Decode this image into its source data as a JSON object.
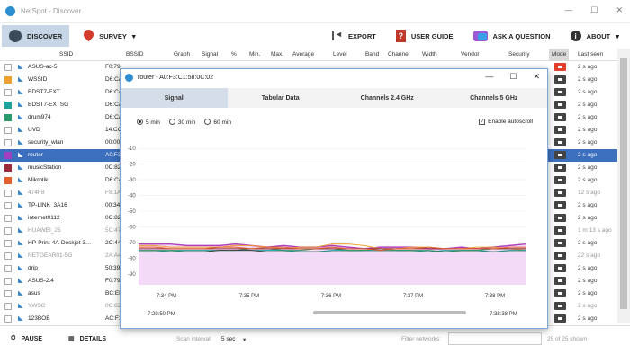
{
  "window": {
    "title": "NetSpot - Discover",
    "controls": [
      "—",
      "☐",
      "✕"
    ]
  },
  "toolbar": {
    "discover_label": "DISCOVER",
    "survey_label": "SURVEY",
    "survey_arrow": "▾",
    "export_label": "EXPORT",
    "guide_label": "USER GUIDE",
    "ask_label": "ASK A QUESTION",
    "about_label": "ABOUT",
    "about_arrow": "▾",
    "guide_glyph": "?",
    "about_glyph": "i"
  },
  "table": {
    "columns": [
      "SSID",
      "BSSID",
      "Graph",
      "Signal",
      "%",
      "Min.",
      "Max.",
      "Average",
      "Level",
      "Band",
      "Channel",
      "Width",
      "Vendor",
      "Security",
      "Mode",
      "Last seen"
    ],
    "rows": [
      {
        "ssid": "ASUS-ac-5",
        "bssid": "F0:79",
        "mode": "ac",
        "last": "2 s ago",
        "check": "none",
        "dim": false
      },
      {
        "ssid": "WSSID",
        "bssid": "D6:CA",
        "mode": "n",
        "last": "2 s ago",
        "check": "#f0a030",
        "dim": false
      },
      {
        "ssid": "BDST7-EXT",
        "bssid": "D6:CA",
        "mode": "n",
        "last": "2 s ago",
        "check": "none",
        "dim": false
      },
      {
        "ssid": "BDST7-EXTSG",
        "bssid": "D6:CA",
        "mode": "n",
        "last": "2 s ago",
        "check": "#1ba39c",
        "dim": false
      },
      {
        "ssid": "drum974",
        "bssid": "D6:CA",
        "mode": "n",
        "last": "2 s ago",
        "check": "#2a9a6a",
        "dim": false
      },
      {
        "ssid": "UVD",
        "bssid": "14:CC",
        "mode": "n",
        "last": "2 s ago",
        "check": "none",
        "dim": false
      },
      {
        "ssid": "security_wlan",
        "bssid": "00:00",
        "mode": "n",
        "last": "2 s ago",
        "check": "none",
        "dim": false
      },
      {
        "ssid": "router",
        "bssid": "A0:F3",
        "mode": "n",
        "last": "2 s ago",
        "check": "#a040c0",
        "dim": false,
        "selected": true
      },
      {
        "ssid": "musicStation",
        "bssid": "0C:82",
        "mode": "n",
        "last": "2 s ago",
        "check": "#9b2b3a",
        "dim": false
      },
      {
        "ssid": "Mikrotik",
        "bssid": "D6:CA",
        "mode": "n",
        "last": "2 s ago",
        "check": "#e06030",
        "dim": false
      },
      {
        "ssid": "474F8",
        "bssid": "F8:1A",
        "mode": "n",
        "last": "12 s ago",
        "check": "none",
        "dim": true
      },
      {
        "ssid": "TP-LINK_3A16",
        "bssid": "00:34",
        "mode": "n",
        "last": "2 s ago",
        "check": "none",
        "dim": false
      },
      {
        "ssid": "internet0112",
        "bssid": "0C:82",
        "mode": "n",
        "last": "2 s ago",
        "check": "none",
        "dim": false
      },
      {
        "ssid": "HUAWEI_25",
        "bssid": "5C:47",
        "mode": "n",
        "last": "1 m 13 s ago",
        "check": "none",
        "dim": true
      },
      {
        "ssid": "HP-Print-4A-Deskjet 3…",
        "bssid": "2C:44",
        "mode": "n",
        "last": "2 s ago",
        "check": "none",
        "dim": false
      },
      {
        "ssid": "NETGEAR01-5G",
        "bssid": "2A:A4",
        "mode": "n",
        "last": "22 s ago",
        "check": "none",
        "dim": true
      },
      {
        "ssid": "drip",
        "bssid": "50:39",
        "mode": "n",
        "last": "2 s ago",
        "check": "none",
        "dim": false
      },
      {
        "ssid": "ASUS-2.4",
        "bssid": "F0:79",
        "mode": "n",
        "last": "2 s ago",
        "check": "none",
        "dim": false
      },
      {
        "ssid": "asus",
        "bssid": "BC:EE",
        "mode": "n",
        "last": "2 s ago",
        "check": "none",
        "dim": false
      },
      {
        "ssid": "YWSC",
        "bssid": "0C:82",
        "mode": "n",
        "last": "2 s ago",
        "check": "none",
        "dim": true
      },
      {
        "ssid": "123BOB",
        "bssid": "AC:F1",
        "mode": "n",
        "last": "2 s ago",
        "check": "none",
        "dim": false
      }
    ]
  },
  "statusbar": {
    "pause_label": "PAUSE",
    "details_label": "DETAILS",
    "scan_interval_label": "Scan interval:",
    "scan_interval_value": "5 sec",
    "filter_label": "Filter networks:",
    "filter_value": "",
    "count_text": "25 of 25 shown"
  },
  "popup": {
    "title": "router - A0:F3:C1:58:0C:02",
    "controls": [
      "—",
      "☐",
      "✕"
    ],
    "tabs": [
      "Signal",
      "Tabular Data",
      "Channels 2.4 GHz",
      "Channels 5 GHz"
    ],
    "active_tab": 0,
    "ranges": [
      "5 min",
      "30 min",
      "60 min"
    ],
    "selected_range": 0,
    "autoscroll_label": "Enable autoscroll",
    "autoscroll_checked": true
  },
  "chart_data": {
    "type": "line",
    "title": "",
    "xlabel": "",
    "ylabel": "",
    "ylim": [
      -97,
      -3
    ],
    "yticks": [
      -10,
      -20,
      -30,
      -40,
      -50,
      -60,
      -70,
      -80,
      -90
    ],
    "xticks": [
      "7:34 PM",
      "7:35 PM",
      "7:36 PM",
      "7:37 PM",
      "7:38 PM"
    ],
    "range_start": "7:29:50 PM",
    "range_end": "7:38:38 PM",
    "fill_color": "#f3daf6",
    "fill_series": "router",
    "series": [
      {
        "name": "router",
        "color": "#b040c0",
        "values": [
          -71,
          -71,
          -71,
          -72,
          -72,
          -72,
          -71,
          -72,
          -73,
          -72,
          -73,
          -73,
          -72,
          -73,
          -74,
          -73,
          -73,
          -73,
          -74,
          -74,
          -73,
          -74,
          -73,
          -72,
          -71
        ]
      },
      {
        "color": "#f0a030",
        "values": [
          -72,
          -72,
          -73,
          -73,
          -73,
          -73,
          -72,
          -72,
          -73,
          -74,
          -73,
          -73,
          -71,
          -71,
          -72,
          -74,
          -74,
          -73,
          -73,
          -74,
          -74,
          -73,
          -73,
          -74,
          -75
        ]
      },
      {
        "color": "#1ba39c",
        "values": [
          -76,
          -76,
          -75,
          -75,
          -75,
          -75,
          -75,
          -75,
          -75,
          -75,
          -76,
          -76,
          -75,
          -75,
          -75,
          -75,
          -75,
          -75,
          -76,
          -75,
          -75,
          -75,
          -76,
          -75,
          -75
        ]
      },
      {
        "color": "#2a9a6a",
        "values": [
          -75,
          -75,
          -75,
          -76,
          -76,
          -75,
          -75,
          -74,
          -74,
          -75,
          -75,
          -74,
          -74,
          -75,
          -75,
          -74,
          -75,
          -75,
          -75,
          -76,
          -75,
          -75,
          -74,
          -74,
          -74
        ]
      },
      {
        "color": "#9b2b3a",
        "values": [
          -74,
          -74,
          -74,
          -74,
          -74,
          -74,
          -74,
          -74,
          -74,
          -74,
          -74,
          -74,
          -74,
          -74,
          -74,
          -74,
          -74,
          -74,
          -74,
          -74,
          -74,
          -74,
          -74,
          -74,
          -74
        ]
      },
      {
        "color": "#e06030",
        "values": [
          -73,
          -73,
          -74,
          -74,
          -74,
          -73,
          -73,
          -74,
          -73,
          -73,
          -74,
          -74,
          -73,
          -74,
          -74,
          -75,
          -74,
          -74,
          -73,
          -74,
          -74,
          -74,
          -74,
          -73,
          -73
        ]
      },
      {
        "color": "#444444",
        "values": [
          -76,
          -76,
          -76,
          -76,
          -76,
          -75,
          -75,
          -75,
          -76,
          -76,
          -76,
          -76,
          -76,
          -76,
          -76,
          -76,
          -76,
          -76,
          -76,
          -76,
          -76,
          -76,
          -76,
          -76,
          -76
        ]
      }
    ]
  }
}
